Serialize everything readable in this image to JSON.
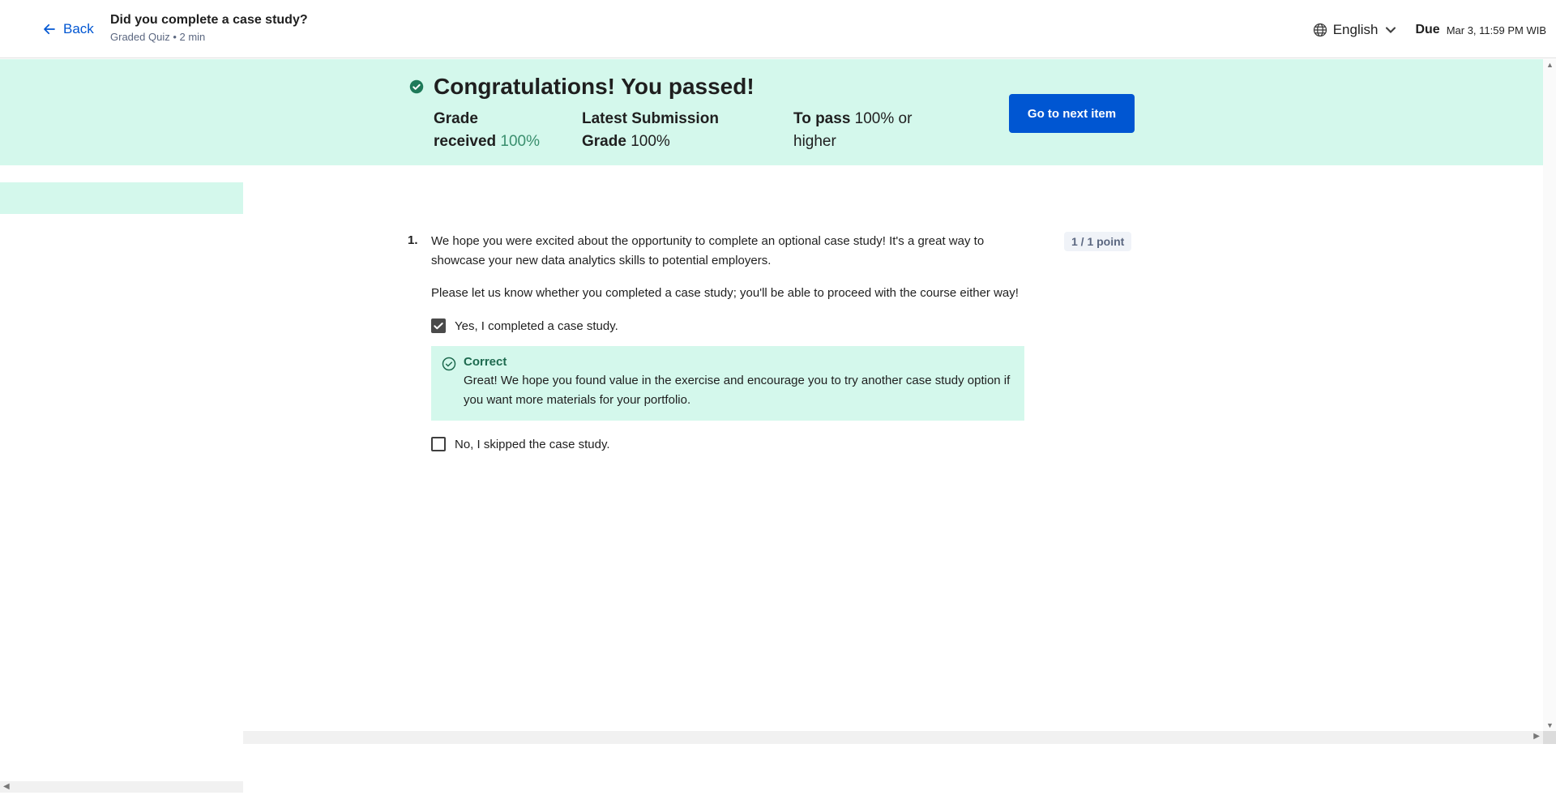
{
  "header": {
    "back_label": "Back",
    "title": "Did you complete a case study?",
    "subtitle": "Graded Quiz • 2 min",
    "language": "English",
    "due_label": "Due",
    "due_date": "Mar 3, 11:59 PM WIB"
  },
  "banner": {
    "title": "Congratulations! You passed!",
    "grade_label_line1": "Grade",
    "grade_label_line2": "received",
    "grade_value": "100%",
    "latest_label_line1": "Latest Submission",
    "latest_label_line2": "Grade",
    "latest_value": "100%",
    "pass_label": "To pass",
    "pass_value_line1": "100% or",
    "pass_value_line2": "higher",
    "next_button": "Go to next item"
  },
  "question": {
    "number": "1.",
    "text": "We hope you were excited about the opportunity to complete an optional case study! It's a great way to showcase your new data analytics skills to potential employers.",
    "instruction": "Please let us know whether you completed a case study; you'll be able to proceed with the course either way!",
    "points": "1 / 1 point",
    "options": [
      {
        "label": "Yes, I completed a case study.",
        "checked": true
      },
      {
        "label": "No, I skipped the case study.",
        "checked": false
      }
    ],
    "feedback": {
      "status": "Correct",
      "text": "Great! We hope you found value in the exercise and encourage you to try another case study option if you want more materials for your portfolio."
    }
  },
  "colors": {
    "accent": "#0056d2",
    "success_bg": "#d4f8ec",
    "success_text": "#1e6a4f",
    "pass_icon": "#1e7a59"
  },
  "icons": {
    "back": "arrow-left-icon",
    "language": "globe-icon",
    "dropdown": "chevron-down-icon",
    "passed": "check-circle-filled-icon",
    "correct": "check-circle-outline-icon",
    "checkbox": "checkmark-icon"
  }
}
